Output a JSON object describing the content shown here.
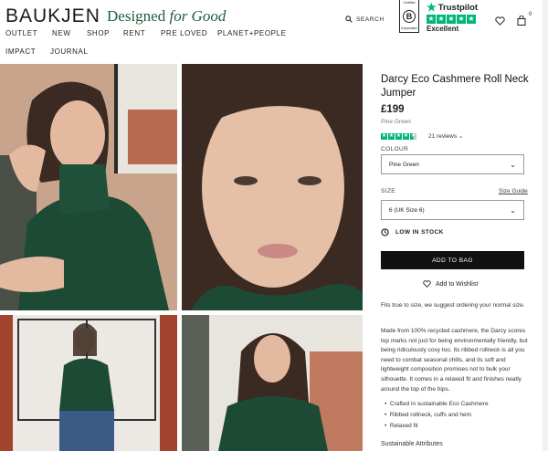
{
  "header": {
    "logo": "BAUKJEN",
    "tagline_main": "Designed ",
    "tagline_italic": "for Good",
    "nav": [
      "OUTLET",
      "NEW",
      "SHOP",
      "RENT",
      "PRE LOVED",
      "PLANET+PEOPLE",
      "IMPACT",
      "JOURNAL"
    ],
    "search_label": "SEARCH",
    "bcorp": {
      "certified": "Certified",
      "letter": "B",
      "corporation": "Corporation"
    },
    "trustpilot": {
      "name": "Trustpilot",
      "rating": "Excellent",
      "stars": 5
    },
    "basket_count": "0"
  },
  "product": {
    "title": "Darcy Eco Cashmere Roll Neck Jumper",
    "price": "£199",
    "color_name": "Pine Green",
    "review_stars": 4.5,
    "reviews": "21 reviews",
    "colour_label": "COLOUR",
    "colour_value": "Pine Green",
    "size_label": "SIZE",
    "size_guide": "Size Guide",
    "size_value": "6 (UK Size 6)",
    "stock": "LOW IN STOCK",
    "add_to_bag": "ADD TO BAG",
    "wishlist": "Add to Wishlist",
    "fit_note": "Fits true to size, we suggest ordering your normal size.",
    "description": "Made from 100% recycled cashmere, the Darcy scores top marks not just for being environmentally friendly, but being ridiculously cosy too. Its ribbed rollneck is all you need to combat seasonal chills, and its soft and lightweight composition promises not to bulk your silhouette. It comes in a relaxed fit and finishes neatly around the top of the hips.",
    "bullets": [
      "Crafted in sustainable Eco Cashmere",
      "Ribbed rollneck, cuffs and hem",
      "Relaxed fit"
    ],
    "sustainable": "Sustainable Attributes"
  },
  "colors": {
    "brand_green": "#1f5c3a",
    "jumper": "#1d4a34",
    "trustpilot": "#00b67a"
  }
}
